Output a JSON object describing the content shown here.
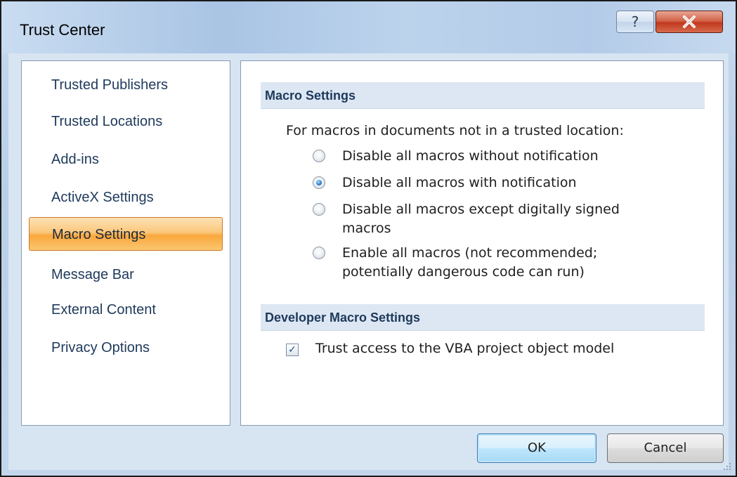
{
  "window": {
    "title": "Trust Center",
    "help_symbol": "?",
    "close_symbol": "X"
  },
  "nav": {
    "items": [
      {
        "label": "Trusted Publishers"
      },
      {
        "label": "Trusted Locations"
      },
      {
        "label": "Add-ins"
      },
      {
        "label": "ActiveX Settings"
      },
      {
        "label": "Macro Settings",
        "selected": true
      },
      {
        "label": "Message Bar"
      },
      {
        "label": "External Content"
      },
      {
        "label": "Privacy Options"
      }
    ]
  },
  "macro_settings": {
    "header": "Macro Settings",
    "intro": "For macros in documents not in a trusted location:",
    "options": [
      {
        "label_line1": "Disable all macros without notification",
        "label_line2": "",
        "checked": false
      },
      {
        "label_line1": "Disable all macros with notification",
        "label_line2": "",
        "checked": true
      },
      {
        "label_line1": "Disable all macros except digitally signed",
        "label_line2": "macros",
        "checked": false
      },
      {
        "label_line1": "Enable all macros (not recommended;",
        "label_line2": "potentially dangerous code can run)",
        "checked": false
      }
    ]
  },
  "developer_settings": {
    "header": "Developer Macro Settings",
    "checkbox_label": "Trust access to the VBA project object model",
    "checkbox_checked": true,
    "check_mark": "✓"
  },
  "buttons": {
    "ok": "OK",
    "cancel": "Cancel"
  },
  "colors": {
    "selected_nav": "#f9a73d",
    "section_header_bg": "#dde7f3",
    "header_text": "#1e395b",
    "close_button": "#c1391e"
  }
}
